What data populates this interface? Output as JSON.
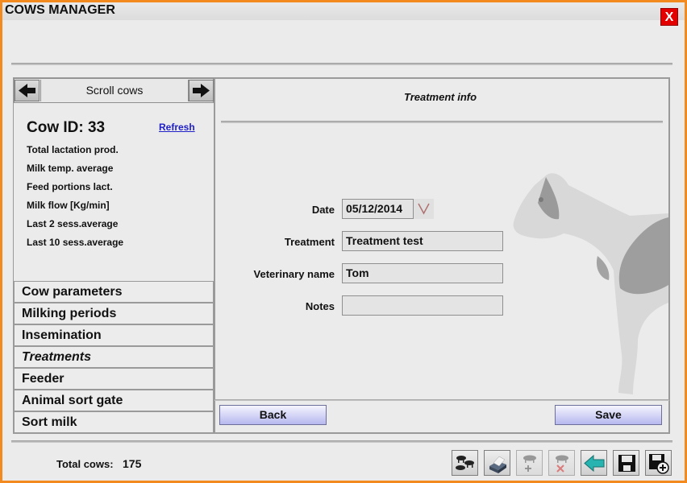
{
  "window": {
    "title": "COWS MANAGER",
    "close_label": "X"
  },
  "scroll": {
    "label": "Scroll cows",
    "prev_icon": "arrow-left-icon",
    "next_icon": "arrow-right-icon"
  },
  "cow": {
    "id_text": "Cow ID: 33",
    "refresh_label": "Refresh",
    "stats": [
      "Total lactation prod.",
      "Milk temp. average",
      "Feed portions lact.",
      "Milk flow [Kg/min]",
      "Last 2 sess.average",
      "Last 10 sess.average"
    ]
  },
  "menu": {
    "items": [
      "Cow parameters",
      "Milking periods",
      "Insemination",
      "Treatments",
      "Feeder",
      "Animal sort gate",
      "Sort milk"
    ],
    "active": "Treatments"
  },
  "treatment": {
    "section_title": "Treatment info",
    "date_label": "Date",
    "date_value": "05/12/2014",
    "treatment_label": "Treatment",
    "treatment_value": "Treatment test",
    "vet_label": "Veterinary name",
    "vet_value": "Tom",
    "notes_label": "Notes",
    "notes_value": ""
  },
  "actions": {
    "back_label": "Back",
    "save_label": "Save"
  },
  "footer": {
    "total_label": "Total cows:",
    "total_value": "175",
    "tools": [
      "cows-list-icon",
      "printer-icon",
      "add-cow-icon",
      "delete-cow-icon",
      "back-arrow-icon",
      "save-disk-icon",
      "save-add-icon"
    ]
  },
  "colors": {
    "frame": "#f28a1f",
    "close": "#e30000",
    "button_gradient_end": "#b7b8ee"
  }
}
